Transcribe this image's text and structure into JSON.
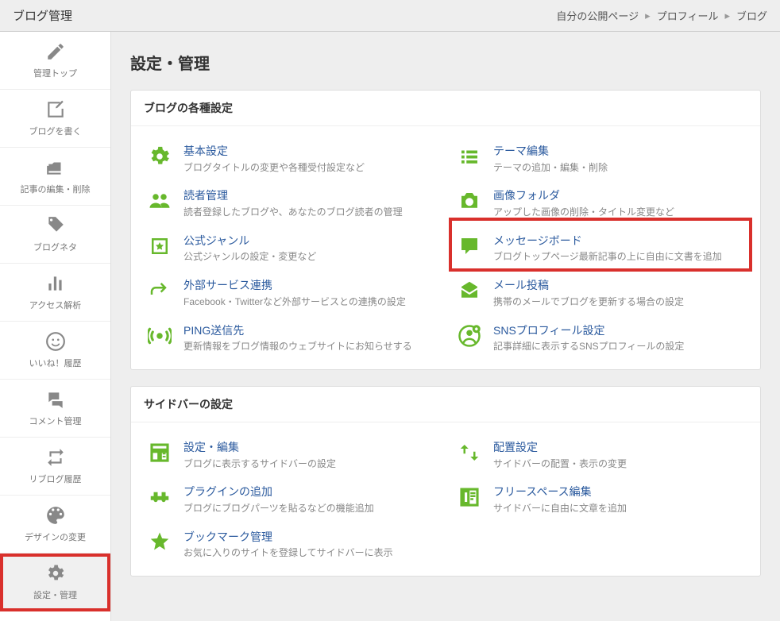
{
  "header": {
    "title": "ブログ管理",
    "breadcrumb": {
      "label": "自分の公開ページ",
      "items": [
        "プロフィール",
        "ブログ"
      ]
    }
  },
  "sidebar": {
    "items": [
      {
        "id": "top",
        "label": "管理トップ"
      },
      {
        "id": "write",
        "label": "ブログを書く"
      },
      {
        "id": "edit",
        "label": "記事の編集・削除"
      },
      {
        "id": "neta",
        "label": "ブログネタ"
      },
      {
        "id": "access",
        "label": "アクセス解析"
      },
      {
        "id": "iine",
        "label": "いいね！履歴"
      },
      {
        "id": "comment",
        "label": "コメント管理"
      },
      {
        "id": "reblog",
        "label": "リブログ履歴"
      },
      {
        "id": "design",
        "label": "デザインの変更"
      },
      {
        "id": "settings",
        "label": "設定・管理"
      }
    ]
  },
  "page": {
    "title": "設定・管理"
  },
  "panels": [
    {
      "title": "ブログの各種設定",
      "items": [
        {
          "icon": "gear",
          "title": "基本設定",
          "desc": "ブログタイトルの変更や各種受付設定など"
        },
        {
          "icon": "list",
          "title": "テーマ編集",
          "desc": "テーマの追加・編集・削除"
        },
        {
          "icon": "users",
          "title": "読者管理",
          "desc": "読者登録したブログや、あなたのブログ読者の管理"
        },
        {
          "icon": "camera",
          "title": "画像フォルダ",
          "desc": "アップした画像の削除・タイトル変更など"
        },
        {
          "icon": "star-box",
          "title": "公式ジャンル",
          "desc": "公式ジャンルの設定・変更など"
        },
        {
          "icon": "message",
          "title": "メッセージボード",
          "desc": "ブログトップページ最新記事の上に自由に文書を追加",
          "highlight": true
        },
        {
          "icon": "share",
          "title": "外部サービス連携",
          "desc": "Facebook・Twitterなど外部サービスとの連携の設定"
        },
        {
          "icon": "mail",
          "title": "メール投稿",
          "desc": "携帯のメールでブログを更新する場合の設定"
        },
        {
          "icon": "ping",
          "title": "PING送信先",
          "desc": "更新情報をブログ情報のウェブサイトにお知らせする"
        },
        {
          "icon": "profile",
          "title": "SNSプロフィール設定",
          "desc": "記事詳細に表示するSNSプロフィールの設定"
        }
      ]
    },
    {
      "title": "サイドバーの設定",
      "items": [
        {
          "icon": "layout",
          "title": "設定・編集",
          "desc": "ブログに表示するサイドバーの設定"
        },
        {
          "icon": "swap",
          "title": "配置設定",
          "desc": "サイドバーの配置・表示の変更"
        },
        {
          "icon": "plugin",
          "title": "プラグインの追加",
          "desc": "ブログにブログパーツを貼るなどの機能追加"
        },
        {
          "icon": "freespace",
          "title": "フリースペース編集",
          "desc": "サイドバーに自由に文章を追加"
        },
        {
          "icon": "star",
          "title": "ブックマーク管理",
          "desc": "お気に入りのサイトを登録してサイドバーに表示",
          "full": true
        }
      ]
    }
  ]
}
